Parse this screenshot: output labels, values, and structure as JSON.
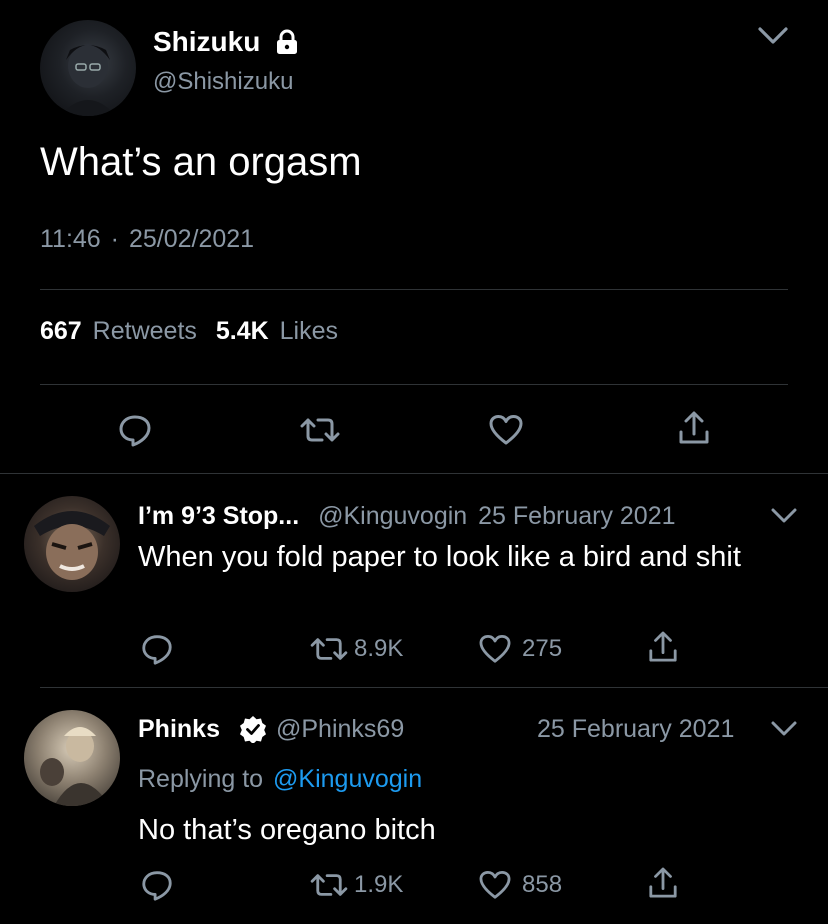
{
  "main_tweet": {
    "display_name": "Shizuku",
    "handle": "@Shishizuku",
    "text": "What’s an orgasm",
    "time": "11:46",
    "separator": "·",
    "date": "25/02/2021",
    "retweets_count": "667",
    "retweets_label": "Retweets",
    "likes_count": "5.4K",
    "likes_label": "Likes"
  },
  "replies": [
    {
      "display_name": "I’m 9’3 Stop...",
      "handle": "@Kinguvogin",
      "date": "25 February 2021",
      "text": "When you fold paper to look like a bird and shit",
      "retweets": "8.9K",
      "likes": "275"
    },
    {
      "display_name": "Phinks",
      "handle": "@Phinks69",
      "date": "25 February 2021",
      "replying_prefix": "Replying to",
      "replying_to": "@Kinguvogin",
      "text": "No that’s oregano bitch",
      "retweets": "1.9K",
      "likes": "858"
    }
  ],
  "colors": {
    "background": "#000000",
    "text": "#ffffff",
    "secondary": "#8b98a5",
    "link": "#1d9bf0",
    "divider": "#2f3336"
  }
}
